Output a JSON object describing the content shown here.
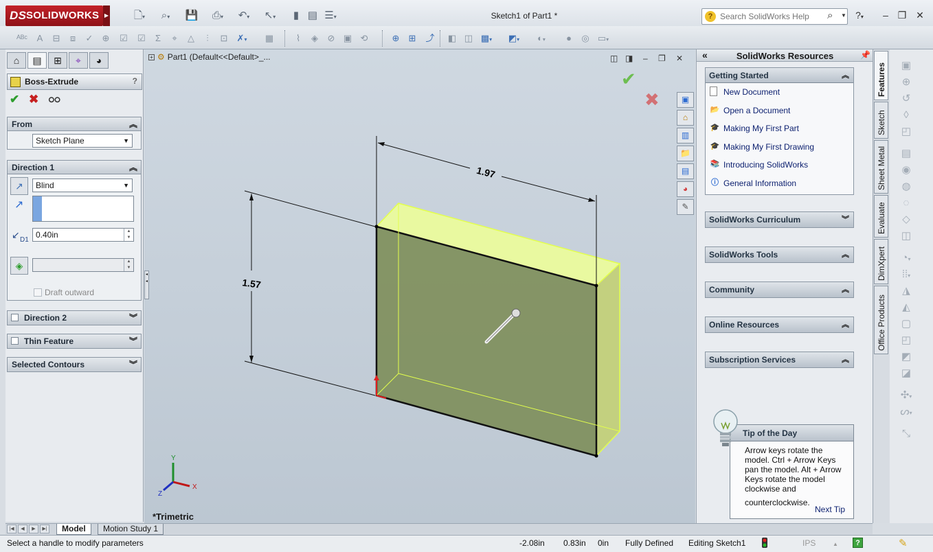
{
  "app": {
    "logo_text": "SOLIDWORKS",
    "logo_mark": "DS",
    "document_title": "Sketch1 of Part1 *",
    "help_search": {
      "placeholder": "Search SolidWorks Help"
    }
  },
  "property_manager": {
    "feature_title": "Boss-Extrude",
    "help_glyph": "?",
    "from": {
      "title": "From",
      "start_condition": "Sketch Plane"
    },
    "direction1": {
      "title": "Direction 1",
      "end_condition": "Blind",
      "depth_value": "0.40in",
      "depth_label": "D1",
      "draft_label": "Draft outward"
    },
    "direction2": {
      "title": "Direction 2"
    },
    "thin_feature": {
      "title": "Thin Feature"
    },
    "selected_contours": {
      "title": "Selected Contours"
    }
  },
  "graphics": {
    "tree_path": "Part1  (Default<<Default>_...",
    "view_name": "*Trimetric",
    "dimensions": {
      "width": "1.97",
      "height": "1.57"
    },
    "triad": {
      "x": "X",
      "y": "Y",
      "z": "Z"
    },
    "part_color": "#7f8f5c",
    "edge_highlight": "#e3ff4c"
  },
  "task_pane": {
    "title": "SolidWorks Resources",
    "getting_started": {
      "title": "Getting Started",
      "items": [
        {
          "label": "New Document",
          "icon": "document-icon"
        },
        {
          "label": "Open a Document",
          "icon": "folder-open-icon"
        },
        {
          "label": "Making My First Part",
          "icon": "graduation-cap-icon"
        },
        {
          "label": "Making My First Drawing",
          "icon": "graduation-cap-icon"
        },
        {
          "label": "Introducing SolidWorks",
          "icon": "books-icon"
        },
        {
          "label": "General Information",
          "icon": "info-icon"
        }
      ]
    },
    "groups": [
      {
        "title": "SolidWorks Curriculum"
      },
      {
        "title": "SolidWorks Tools"
      },
      {
        "title": "Community"
      },
      {
        "title": "Online Resources"
      },
      {
        "title": "Subscription Services"
      }
    ],
    "tip": {
      "title": "Tip of the Day",
      "text_1": "Arrow keys rotate the model. Ctrl + Arrow Keys pan the model. Alt + Arrow Keys rotate the model clockwise and",
      "text_2": "counterclockwise.",
      "next": "Next Tip"
    }
  },
  "vertical_tabs": [
    "Features",
    "Sketch",
    "Sheet Metal",
    "Evaluate",
    "DimXpert",
    "Office Products"
  ],
  "bottom_tabs": [
    "Model",
    "Motion Study 1"
  ],
  "status": {
    "message": "Select a handle to modify parameters",
    "x": "-2.08in",
    "y": "0.83in",
    "z": "0in",
    "state": "Fully Defined",
    "editing": "Editing Sketch1",
    "units": "IPS",
    "help": "?"
  }
}
